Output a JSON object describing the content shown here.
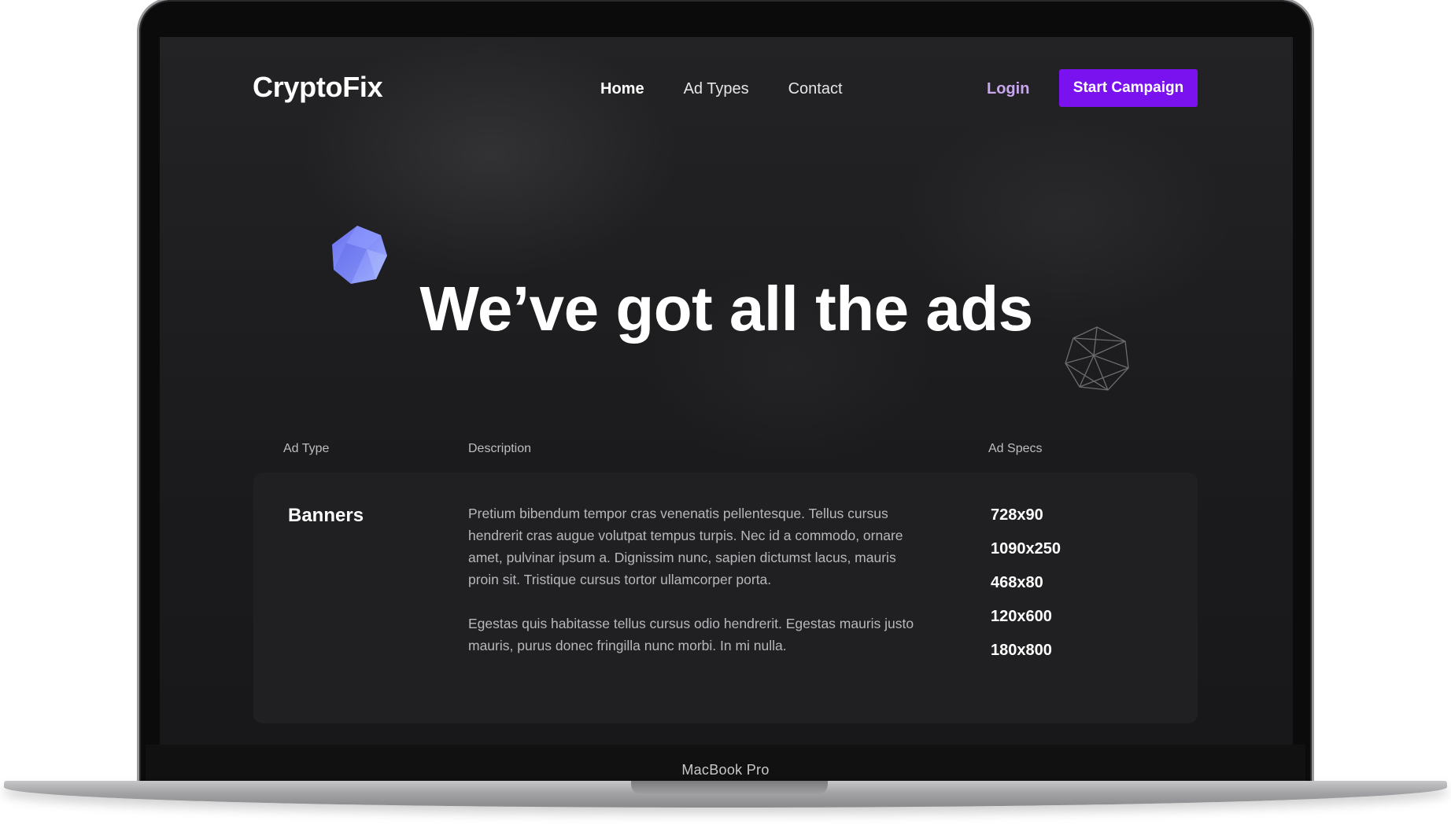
{
  "device": {
    "label": "MacBook Pro"
  },
  "nav": {
    "logo": "CryptoFix",
    "links": [
      "Home",
      "Ad Types",
      "Contact"
    ],
    "login": "Login",
    "cta": "Start Campaign"
  },
  "hero": {
    "title": "We’ve got all the ads"
  },
  "table": {
    "headers": {
      "type": "Ad Type",
      "description": "Description",
      "specs": "Ad Specs"
    },
    "rows": [
      {
        "type": "Banners",
        "description": [
          "Pretium bibendum tempor cras venenatis pellentesque. Tellus cursus hendrerit cras augue volutpat tempus turpis. Nec id a commodo, ornare amet, pulvinar ipsum a. Dignissim nunc, sapien dictumst lacus, mauris proin sit. Tristique cursus tortor ullamcorper porta.",
          "Egestas quis habitasse tellus cursus odio hendrerit. Egestas mauris justo mauris, purus donec fringilla nunc morbi. In mi nulla."
        ],
        "specs": [
          "728x90",
          "1090x250",
          "468x80",
          "120x600",
          "180x800"
        ]
      }
    ]
  },
  "colors": {
    "accent": "#7a12f0",
    "login": "#c9a7ee",
    "background": "#1a1a1c",
    "card": "#202023"
  },
  "icons": {
    "gem": "gem-icon",
    "wireframe": "wireframe-gem-icon"
  }
}
